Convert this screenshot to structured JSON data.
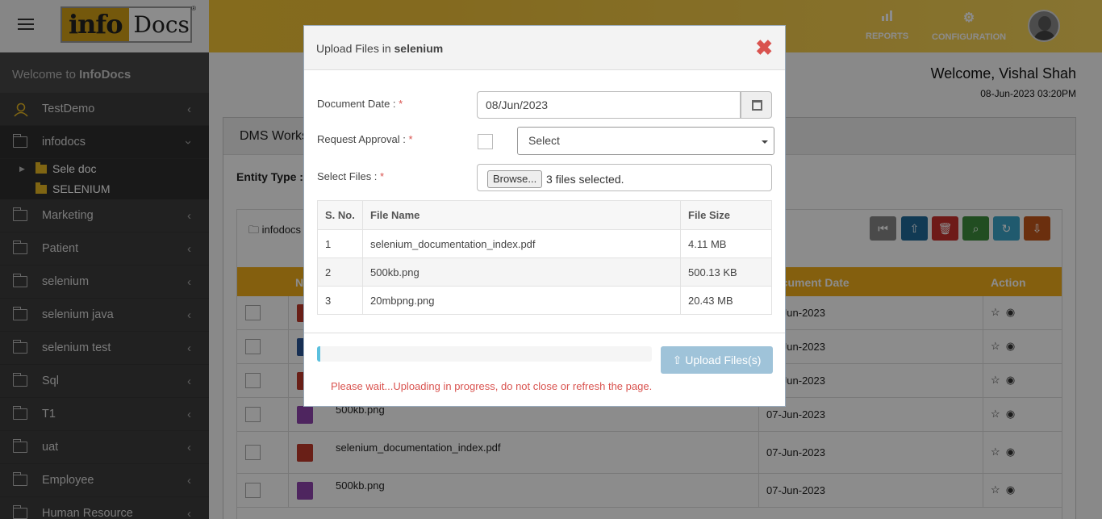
{
  "header": {
    "logo_info": "info",
    "logo_docs": "Docs",
    "logo_reg": "®",
    "reports": "REPORTS",
    "configuration": "CONFIGURATION"
  },
  "sidebar": {
    "welcome_prefix": "Welcome to",
    "welcome_brand": "InfoDocs",
    "items": [
      {
        "label": "TestDemo",
        "icon": "user-icon"
      },
      {
        "label": "infodocs",
        "icon": "folder-icon",
        "expanded": true
      },
      {
        "label": "Marketing",
        "icon": "folder-icon"
      },
      {
        "label": "Patient",
        "icon": "folder-icon"
      },
      {
        "label": "selenium",
        "icon": "folder-icon"
      },
      {
        "label": "selenium java",
        "icon": "folder-icon"
      },
      {
        "label": "selenium test",
        "icon": "folder-icon"
      },
      {
        "label": "Sql",
        "icon": "folder-icon"
      },
      {
        "label": "T1",
        "icon": "folder-icon"
      },
      {
        "label": "uat",
        "icon": "folder-icon"
      },
      {
        "label": "Employee",
        "icon": "folder-icon"
      },
      {
        "label": "Human Resource",
        "icon": "folder-icon"
      }
    ],
    "subitems": [
      {
        "label": "Sele doc"
      },
      {
        "label": "SELENIUM"
      }
    ]
  },
  "main": {
    "welcome_user": "Welcome, Vishal Shah",
    "datetime": "08-Jun-2023 03:20PM",
    "panel_title": "DMS Workspace",
    "entity_label": "Entity Type :",
    "breadcrumb": "infodocs",
    "grid": {
      "col_name": "N",
      "col_date": "Document Date",
      "col_action": "Action",
      "rows": [
        {
          "name": "",
          "date": "07-Jun-2023",
          "icon_color": "#c0392b"
        },
        {
          "name": "",
          "date": "07-Jun-2023",
          "icon_color": "#2b5797"
        },
        {
          "name": "",
          "date": "07-Jun-2023",
          "icon_color": "#c0392b"
        },
        {
          "name": "500kb.png",
          "date": "07-Jun-2023",
          "icon_color": "#8e44ad"
        },
        {
          "name": "selenium_documentation_index.pdf",
          "date": "07-Jun-2023",
          "icon_color": "#c0392b"
        },
        {
          "name": "500kb.png",
          "date": "07-Jun-2023",
          "icon_color": "#8e44ad"
        }
      ]
    }
  },
  "modal": {
    "title_prefix": "Upload Files in",
    "title_target": "selenium",
    "close_glyph": "✖",
    "doc_date_label": "Document Date :",
    "doc_date_value": "08/Jun/2023",
    "approval_label": "Request Approval :",
    "approval_select": "Select",
    "select_files_label": "Select Files :",
    "browse_label": "Browse...",
    "files_selected": "3 files selected.",
    "required_mark": "*",
    "table": {
      "headers": [
        "S. No.",
        "File Name",
        "File Size"
      ],
      "rows": [
        {
          "sno": "1",
          "name": "selenium_documentation_index.pdf",
          "size": "4.11 MB"
        },
        {
          "sno": "2",
          "name": "500kb.png",
          "size": "500.13 KB"
        },
        {
          "sno": "3",
          "name": "20mbpng.png",
          "size": "20.43 MB"
        }
      ]
    },
    "progress_pct": 1,
    "upload_button": "Upload Files(s)",
    "wait_message": "Please wait...Uploading in progress, do not close or refresh the page."
  }
}
